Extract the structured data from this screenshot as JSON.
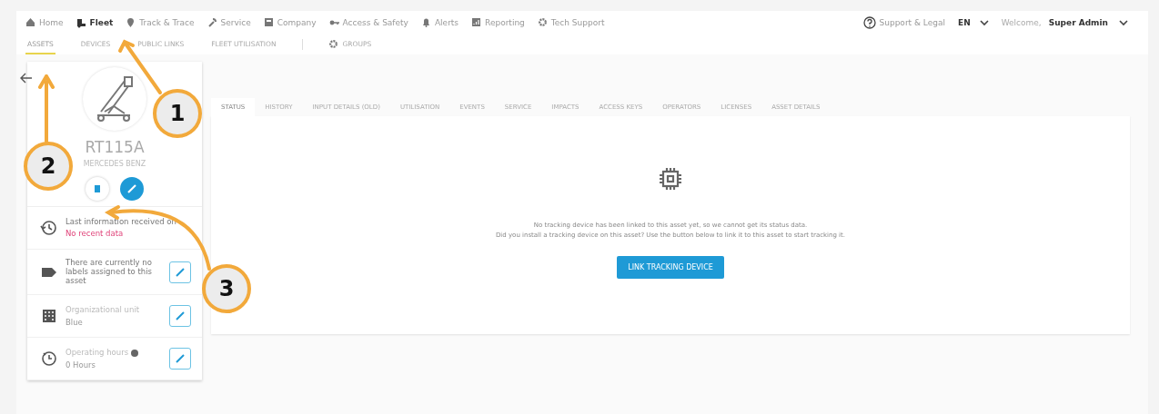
{
  "nav": {
    "items": [
      {
        "label": "Home",
        "selected": false
      },
      {
        "label": "Fleet",
        "selected": true
      },
      {
        "label": "Track & Trace",
        "selected": false
      },
      {
        "label": "Service",
        "selected": false
      },
      {
        "label": "Company",
        "selected": false
      },
      {
        "label": "Access & Safety",
        "selected": false
      },
      {
        "label": "Alerts",
        "selected": false
      },
      {
        "label": "Reporting",
        "selected": false
      },
      {
        "label": "Tech Support",
        "selected": false
      }
    ],
    "support": "Support & Legal",
    "language": "EN",
    "welcome": "Welcome,",
    "user": "Super Admin"
  },
  "subnav": [
    {
      "label": "ASSETS",
      "selected": true,
      "kind": "tab"
    },
    {
      "label": "DEVICES",
      "selected": false,
      "kind": "tab"
    },
    {
      "label": "PUBLIC LINKS",
      "selected": false,
      "kind": "tab"
    },
    {
      "label": "FLEET UTILISATION",
      "selected": false,
      "kind": "tab"
    },
    {
      "label": "GROUPS",
      "selected": false,
      "kind": "gear"
    }
  ],
  "asset": {
    "name": "RT115A",
    "make": "MERCEDES BENZ",
    "info": [
      {
        "kind": "history",
        "label": "Last information received on",
        "value": "No recent data",
        "editable": false
      },
      {
        "kind": "label",
        "label": "There are currently no labels assigned to this asset",
        "editable": true
      },
      {
        "kind": "org",
        "label": "Organizational unit",
        "value": "Blue",
        "editable": true
      },
      {
        "kind": "hours",
        "label": "Operating hours",
        "value": "0 Hours",
        "editable": true,
        "hint": true
      }
    ]
  },
  "tabs": [
    {
      "label": "STATUS",
      "selected": true
    },
    {
      "label": "HISTORY",
      "selected": false
    },
    {
      "label": "INPUT DETAILS (OLD)",
      "selected": false
    },
    {
      "label": "UTILISATION",
      "selected": false
    },
    {
      "label": "EVENTS",
      "selected": false
    },
    {
      "label": "SERVICE",
      "selected": false
    },
    {
      "label": "IMPACTS",
      "selected": false
    },
    {
      "label": "ACCESS KEYS",
      "selected": false
    },
    {
      "label": "OPERATORS",
      "selected": false
    },
    {
      "label": "LICENSES",
      "selected": false
    },
    {
      "label": "ASSET DETAILS",
      "selected": false
    }
  ],
  "status": {
    "message": "No tracking device has been linked to this asset yet, so we cannot get its status data.",
    "hint": "Did you install a tracking device on this asset? Use the button below to link it to this asset to start tracking it.",
    "button": "LINK TRACKING DEVICE"
  },
  "callouts": [
    {
      "label": "1"
    },
    {
      "label": "2"
    },
    {
      "label": "3"
    }
  ]
}
